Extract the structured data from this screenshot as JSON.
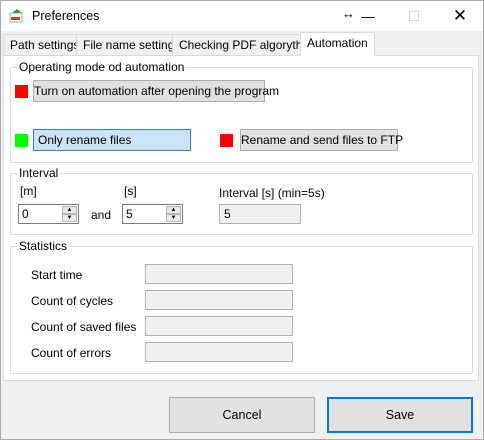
{
  "window": {
    "title": "Preferences"
  },
  "tabs": [
    {
      "label": "Path settings"
    },
    {
      "label": "File name settings"
    },
    {
      "label": "Checking PDF algorythm"
    },
    {
      "label": "Automation"
    }
  ],
  "operating_mode": {
    "legend": "Operating mode od automation",
    "auto_start_label": "Turn on automation after opening the program",
    "auto_start_color": "#ff0000",
    "rename_only_label": "Only rename files",
    "rename_only_color": "#00ff00",
    "rename_ftp_label": "Rename and send files to FTP",
    "rename_ftp_color": "#ff0000"
  },
  "interval": {
    "legend": "Interval",
    "minutes_label": "[m]",
    "minutes_value": "0",
    "and_label": "and",
    "seconds_label": "[s]",
    "seconds_value": "5",
    "total_label": "Interval [s] (min=5s)",
    "total_value": "5"
  },
  "statistics": {
    "legend": "Statistics",
    "rows": [
      {
        "label": "Start time",
        "value": ""
      },
      {
        "label": "Count of cycles",
        "value": ""
      },
      {
        "label": "Count of saved files",
        "value": ""
      },
      {
        "label": "Count of errors",
        "value": ""
      }
    ]
  },
  "footer": {
    "cancel_label": "Cancel",
    "save_label": "Save",
    "accent": "#0078d7"
  }
}
